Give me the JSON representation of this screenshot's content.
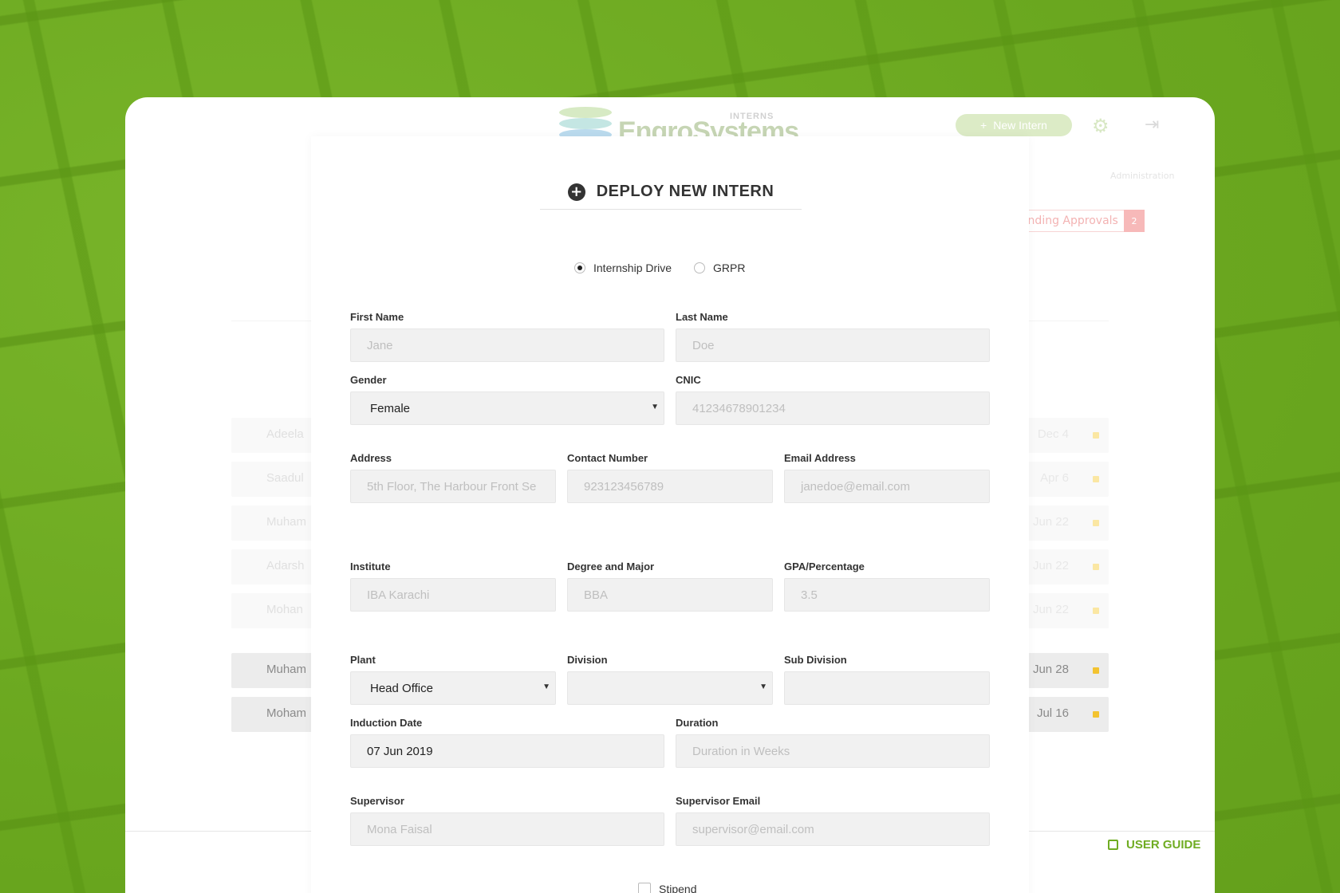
{
  "app": {
    "logo_text": "EngroSystems",
    "logo_sub": "INTERNS",
    "new_intern_label": "New Intern",
    "admin_link": "Administration",
    "pending_label": "Pending Approvals",
    "pending_count": "2",
    "user_guide_label": "USER GUIDE"
  },
  "background_rows": [
    {
      "name": "Adeela",
      "date": "Dec 4"
    },
    {
      "name": "Saadul",
      "date": "Apr 6"
    },
    {
      "name": "Muham",
      "date": "Jun 22"
    },
    {
      "name": "Adarsh",
      "date": "Jun 22"
    },
    {
      "name": "Mohan",
      "date": "Jun 22"
    },
    {
      "name": "Muham",
      "date": "Jun 28"
    },
    {
      "name": "Moham",
      "date": "Jul 16"
    }
  ],
  "modal": {
    "title": "DEPLOY NEW INTERN",
    "radio_options": [
      {
        "label": "Internship Drive",
        "selected": true
      },
      {
        "label": "GRPR",
        "selected": false
      }
    ],
    "fields": {
      "first_name": {
        "label": "First Name",
        "placeholder": "Jane"
      },
      "last_name": {
        "label": "Last Name",
        "placeholder": "Doe"
      },
      "gender": {
        "label": "Gender",
        "value": "Female"
      },
      "cnic": {
        "label": "CNIC",
        "placeholder": "41234678901234"
      },
      "address": {
        "label": "Address",
        "placeholder": "5th Floor, The Harbour Front Se"
      },
      "contact": {
        "label": "Contact Number",
        "placeholder": "923123456789"
      },
      "email": {
        "label": "Email Address",
        "placeholder": "janedoe@email.com"
      },
      "institute": {
        "label": "Institute",
        "placeholder": "IBA Karachi"
      },
      "degree": {
        "label": "Degree and Major",
        "placeholder": "BBA"
      },
      "gpa": {
        "label": "GPA/Percentage",
        "placeholder": "3.5"
      },
      "plant": {
        "label": "Plant",
        "value": "Head Office"
      },
      "division": {
        "label": "Division",
        "value": ""
      },
      "sub_division": {
        "label": "Sub Division",
        "placeholder": ""
      },
      "induction_date": {
        "label": "Induction Date",
        "value": "07 Jun 2019"
      },
      "duration": {
        "label": "Duration",
        "placeholder": "Duration in Weeks"
      },
      "supervisor": {
        "label": "Supervisor",
        "placeholder": "Mona Faisal"
      },
      "supervisor_email": {
        "label": "Supervisor Email",
        "placeholder": "supervisor@email.com"
      }
    },
    "stipend_label": "Stipend"
  }
}
